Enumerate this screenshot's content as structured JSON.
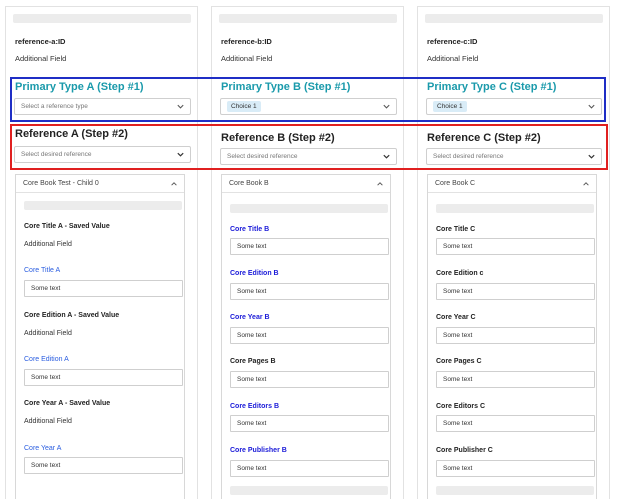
{
  "columns": [
    {
      "ref_id": "reference-a:ID",
      "additional_field": "Additional Field",
      "primary_title": "Primary Type A (Step #1)",
      "primary_select": "Select a reference type",
      "reference_title": "Reference A (Step #2)",
      "reference_select": "Select desired reference",
      "sub_header": "Core Book Test - Child 0",
      "fields": [
        {
          "label": "Core Title A - Saved Value",
          "style": "dark",
          "type": "text",
          "value": "Additional Field"
        },
        {
          "label": "Core Title A",
          "style": "blue-light",
          "type": "input",
          "value": "Some text"
        },
        {
          "label": "Core Edition A - Saved Value",
          "style": "dark",
          "type": "text",
          "value": "Additional Field"
        },
        {
          "label": "Core Edition A",
          "style": "blue-light",
          "type": "input",
          "value": "Some text"
        },
        {
          "label": "Core Year A - Saved Value",
          "style": "dark",
          "type": "text",
          "value": "Additional Field"
        },
        {
          "label": "Core Year A",
          "style": "blue-light",
          "type": "input",
          "value": "Some text"
        }
      ]
    },
    {
      "ref_id": "reference-b:ID",
      "additional_field": "Additional Field",
      "primary_title": "Primary Type B (Step #1)",
      "primary_select": "Choice 1",
      "reference_title": "Reference B (Step #2)",
      "reference_select": "Select desired reference",
      "sub_header": "Core Book B",
      "fields": [
        {
          "label": "Core Title B",
          "style": "blue",
          "value": "Some text"
        },
        {
          "label": "Core Edition B",
          "style": "blue",
          "value": "Some text"
        },
        {
          "label": "Core Year B",
          "style": "blue",
          "value": "Some text"
        },
        {
          "label": "Core Pages B",
          "style": "dark",
          "value": "Some text"
        },
        {
          "label": "Core Editors B",
          "style": "blue",
          "value": "Some text"
        },
        {
          "label": "Core Publisher B",
          "style": "blue",
          "value": "Some text"
        }
      ]
    },
    {
      "ref_id": "reference-c:ID",
      "additional_field": "Additional Field",
      "primary_title": "Primary Type C (Step #1)",
      "primary_select": "Choice 1",
      "reference_title": "Reference C (Step #2)",
      "reference_select": "Select desired reference",
      "sub_header": "Core Book C",
      "fields": [
        {
          "label": "Core Title C",
          "style": "dark",
          "value": "Some text"
        },
        {
          "label": "Core Edition c",
          "style": "dark",
          "value": "Some text"
        },
        {
          "label": "Core Year C",
          "style": "dark",
          "value": "Some text"
        },
        {
          "label": "Core Pages C",
          "style": "dark",
          "value": "Some text"
        },
        {
          "label": "Core Editors C",
          "style": "dark",
          "value": "Some text"
        },
        {
          "label": "Core Publisher C",
          "style": "dark",
          "value": "Some text"
        }
      ]
    }
  ],
  "colors": {
    "highlight_step1": "#1f2ec5",
    "highlight_step2": "#e02020",
    "primary_title": "#1a9aab"
  },
  "icons": {
    "select_chevron": "chevron-down-icon",
    "accordion_chevron": "chevron-up-icon"
  }
}
